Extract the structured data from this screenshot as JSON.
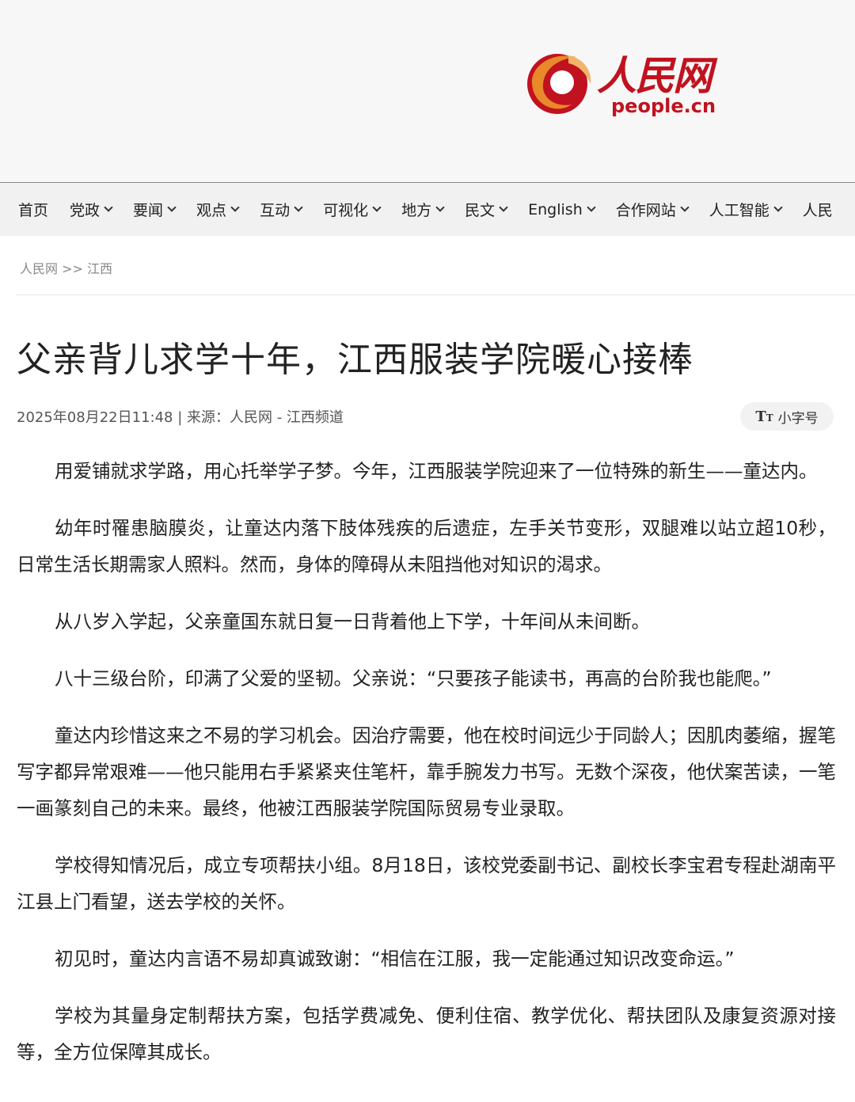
{
  "brand": {
    "logo_cn": "人民网",
    "logo_en": "people.cn"
  },
  "nav": {
    "items": [
      {
        "label": "首页",
        "has_dropdown": false
      },
      {
        "label": "党政",
        "has_dropdown": true
      },
      {
        "label": "要闻",
        "has_dropdown": true
      },
      {
        "label": "观点",
        "has_dropdown": true
      },
      {
        "label": "互动",
        "has_dropdown": true
      },
      {
        "label": "可视化",
        "has_dropdown": true
      },
      {
        "label": "地方",
        "has_dropdown": true
      },
      {
        "label": "民文",
        "has_dropdown": true
      },
      {
        "label": "English",
        "has_dropdown": true
      },
      {
        "label": "合作网站",
        "has_dropdown": true
      },
      {
        "label": "人工智能",
        "has_dropdown": true
      },
      {
        "label": "人民",
        "has_dropdown": false
      }
    ]
  },
  "breadcrumb": {
    "text": "人民网 >> 江西"
  },
  "article": {
    "title": "父亲背儿求学十年，江西服装学院暖心接棒",
    "meta": "2025年08月22日11:48 | 来源：人民网 - 江西频道",
    "font_toggle_label": "小字号",
    "paragraphs": [
      "用爱铺就求学路，用心托举学子梦。今年，江西服装学院迎来了一位特殊的新生——童达内。",
      "幼年时罹患脑膜炎，让童达内落下肢体残疾的后遗症，左手关节变形，双腿难以站立超10秒，日常生活长期需家人照料。然而，身体的障碍从未阻挡他对知识的渴求。",
      "从八岁入学起，父亲童国东就日复一日背着他上下学，十年间从未间断。",
      "八十三级台阶，印满了父爱的坚韧。父亲说：“只要孩子能读书，再高的台阶我也能爬。”",
      "童达内珍惜这来之不易的学习机会。因治疗需要，他在校时间远少于同龄人；因肌肉萎缩，握笔写字都异常艰难——他只能用右手紧紧夹住笔杆，靠手腕发力书写。无数个深夜，他伏案苦读，一笔一画篆刻自己的未来。最终，他被江西服装学院国际贸易专业录取。",
      "学校得知情况后，成立专项帮扶小组。8月18日，该校党委副书记、副校长李宝君专程赴湖南平江县上门看望，送去学校的关怀。",
      "初见时，童达内言语不易却真诚致谢：“相信在江服，我一定能通过知识改变命运。”",
      "学校为其量身定制帮扶方案，包括学费减免、便利住宿、教学优化、帮扶团队及康复资源对接等，全方位保障其成长。"
    ]
  },
  "colors": {
    "brand_red": "#c1121f",
    "brand_orange": "#e8892a"
  }
}
